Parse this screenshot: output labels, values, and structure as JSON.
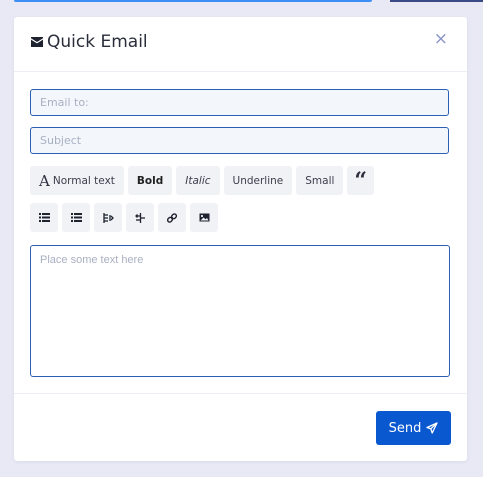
{
  "modal": {
    "title": "Quick Email",
    "close_symbol": "×",
    "title_icon": "envelope-icon"
  },
  "form": {
    "email_placeholder": "Email to:",
    "subject_placeholder": "Subject",
    "body_placeholder": "Place some text here"
  },
  "toolbar_row1": {
    "normal_text_glyph": "A",
    "normal_text_label": "Normal text",
    "bold_label": "Bold",
    "italic_label": "Italic",
    "underline_label": "Underline",
    "small_label": "Small",
    "blockquote_glyph": "“"
  },
  "toolbar_row2_icons": [
    "unordered-list-icon",
    "ordered-list-icon",
    "outdent-icon",
    "indent-icon",
    "link-icon",
    "image-icon"
  ],
  "footer": {
    "send_label": "Send",
    "send_icon": "paper-plane-icon"
  },
  "colors": {
    "primary": "#0a58d0",
    "background": "#e8e9f4",
    "field_border": "#2a5fb3",
    "close_icon": "#8a93c8"
  }
}
